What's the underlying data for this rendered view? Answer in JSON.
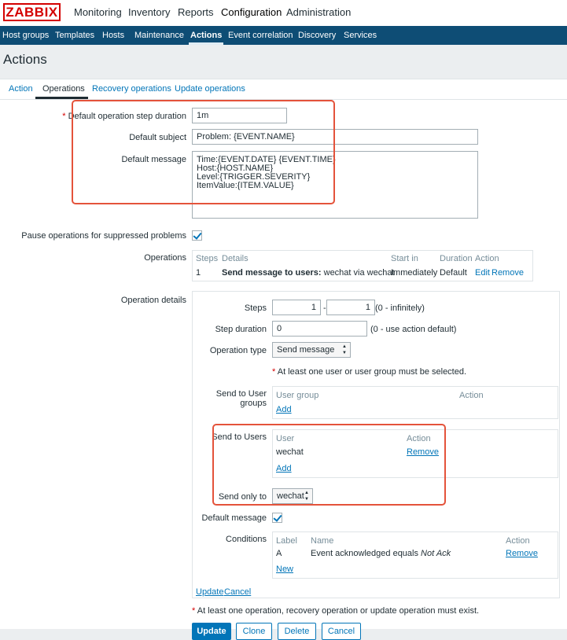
{
  "logo": "ZABBIX",
  "top_nav": [
    "Monitoring",
    "Inventory",
    "Reports",
    "Configuration",
    "Administration"
  ],
  "sub_nav": [
    "Host groups",
    "Templates",
    "Hosts",
    "Maintenance",
    "Actions",
    "Event correlation",
    "Discovery",
    "Services"
  ],
  "page_title": "Actions",
  "tabs": [
    "Action",
    "Operations",
    "Recovery operations",
    "Update operations"
  ],
  "form": {
    "step_duration_label": "Default operation step duration",
    "step_duration_value": "1m",
    "subject_label": "Default subject",
    "subject_value": "Problem: {EVENT.NAME}",
    "message_label": "Default message",
    "message_value": "Time:{EVENT.DATE} {EVENT.TIME}\nHost:{HOST.NAME}\nLevel:{TRIGGER.SEVERITY}\nItemValue:{ITEM.VALUE}",
    "pause_label": "Pause operations for suppressed problems",
    "pause_checked": true,
    "operations_label": "Operations"
  },
  "operations_table": {
    "headers": [
      "Steps",
      "Details",
      "Start in",
      "Duration",
      "Action"
    ],
    "row": {
      "steps": "1",
      "details_bold": "Send message to users:",
      "details_rest": " wechat via wechat",
      "start_in": "Immediately",
      "duration": "Default",
      "edit": "Edit",
      "remove": "Remove"
    }
  },
  "details": {
    "label": "Operation details",
    "steps_label": "Steps",
    "steps_from": "1",
    "steps_sep": "-",
    "steps_to": "1",
    "steps_hint": "(0 - infinitely)",
    "step_duration_label": "Step duration",
    "step_duration_value": "0",
    "step_duration_hint": "(0 - use action default)",
    "op_type_label": "Operation type",
    "op_type_value": "Send message",
    "warning": "At least one user or user group must be selected.",
    "user_groups_label": "Send to User groups",
    "user_groups_headers": [
      "User group",
      "Action"
    ],
    "user_groups_add": "Add",
    "users_label": "Send to Users",
    "users_headers": [
      "User",
      "Action"
    ],
    "users_row_user": "wechat",
    "users_row_remove": "Remove",
    "users_add": "Add",
    "send_only_label": "Send only to",
    "send_only_value": "wechat",
    "default_message_label": "Default message",
    "conditions_label": "Conditions",
    "conditions_headers": [
      "Label",
      "Name",
      "Action"
    ],
    "conditions_row_label": "A",
    "conditions_row_name": "Event acknowledged equals ",
    "conditions_row_name_italic": "Not Ack",
    "conditions_row_remove": "Remove",
    "conditions_new": "New",
    "update_link": "Update",
    "cancel_link": "Cancel"
  },
  "footer": {
    "warning": "At least one operation, recovery operation or update operation must exist.",
    "buttons": [
      "Update",
      "Clone",
      "Delete",
      "Cancel"
    ]
  },
  "colors": {
    "header_blue": "#0e4d75",
    "link_blue": "#0275b8",
    "logo_red": "#d40000",
    "highlight_red": "#e4533b"
  }
}
